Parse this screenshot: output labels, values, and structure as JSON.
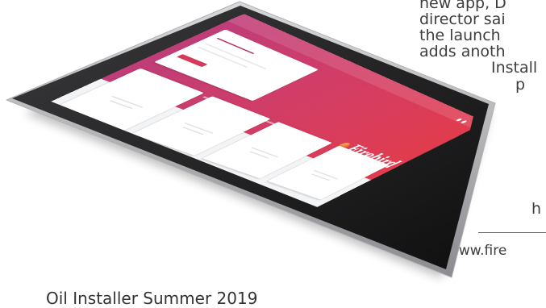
{
  "article": {
    "lines": [
      "new app, D",
      "director sai",
      "the launch",
      "adds anoth",
      "Install",
      "p",
      "h"
    ],
    "url": "www.fire"
  },
  "caption": "Oil Installer Summer 2019",
  "screen": {
    "brand": "Firebird",
    "colors": {
      "hero_start": "#c03d78",
      "hero_end": "#e13c4d",
      "brand_red": "#d73a4e"
    }
  }
}
